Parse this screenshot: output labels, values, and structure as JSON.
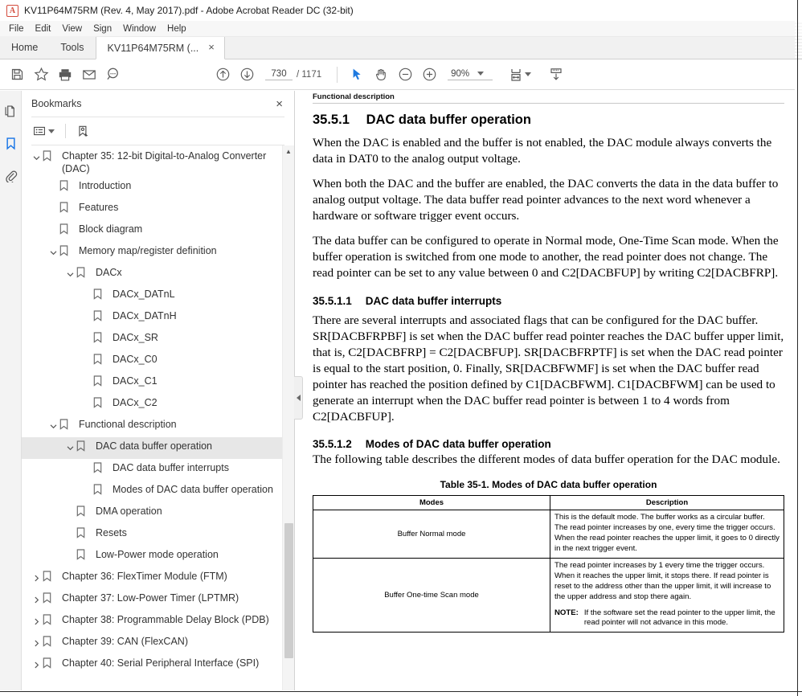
{
  "window": {
    "title": "KV11P64M75RM (Rev. 4, May 2017).pdf - Adobe Acrobat Reader DC (32-bit)",
    "app_icon": "pdf-document-icon",
    "icon_glyph": "A"
  },
  "menubar": {
    "items": [
      {
        "label": "File"
      },
      {
        "label": "Edit"
      },
      {
        "label": "View"
      },
      {
        "label": "Sign"
      },
      {
        "label": "Window"
      },
      {
        "label": "Help"
      }
    ]
  },
  "tabs": [
    {
      "label": "Home",
      "type": "home"
    },
    {
      "label": "Tools",
      "type": "tools"
    },
    {
      "label": "KV11P64M75RM (...",
      "type": "document",
      "close": "×",
      "active": true
    }
  ],
  "toolbar": {
    "left_icons": [
      {
        "name": "save-icon",
        "label": "Save file"
      },
      {
        "name": "star-icon",
        "label": "Add to favorites"
      },
      {
        "name": "print-icon",
        "label": "Print file"
      },
      {
        "name": "email-icon",
        "label": "Send by email"
      },
      {
        "name": "search-icon",
        "label": "Find"
      }
    ],
    "prev_page_label": "Previous page",
    "next_page_label": "Next page",
    "page_number": "730",
    "page_total": "/ 1171",
    "select_tool_label": "Select tool",
    "hand_tool_label": "Hand tool",
    "zoom_out_label": "Zoom out",
    "zoom_in_label": "Zoom in",
    "zoom_value": "90%",
    "fit_label": "Fit page width",
    "scroll_mode_label": "Scroll mode"
  },
  "rail": {
    "items": [
      {
        "name": "page-thumbnails-icon",
        "label": "Page Thumbnails",
        "active": false
      },
      {
        "name": "bookmarks-icon",
        "label": "Bookmarks",
        "active": true
      },
      {
        "name": "attachments-icon",
        "label": "Attachments",
        "active": false
      }
    ]
  },
  "sidebar": {
    "title": "Bookmarks",
    "close_label": "×",
    "tools": [
      {
        "name": "bookmark-options-icon",
        "label": "Options"
      },
      {
        "name": "new-bookmark-icon",
        "label": "New bookmark"
      }
    ],
    "bookmarks": [
      {
        "label": "Chapter 35: 12-bit Digital-to-Analog Converter (DAC)",
        "indent": 0,
        "twisty": "open",
        "selected": false
      },
      {
        "label": "Introduction",
        "indent": 1,
        "twisty": "none",
        "selected": false
      },
      {
        "label": "Features",
        "indent": 1,
        "twisty": "none",
        "selected": false
      },
      {
        "label": "Block diagram",
        "indent": 1,
        "twisty": "none",
        "selected": false
      },
      {
        "label": "Memory map/register definition",
        "indent": 1,
        "twisty": "open",
        "selected": false
      },
      {
        "label": "DACx",
        "indent": 2,
        "twisty": "open",
        "selected": false
      },
      {
        "label": "DACx_DATnL",
        "indent": 3,
        "twisty": "none",
        "selected": false
      },
      {
        "label": "DACx_DATnH",
        "indent": 3,
        "twisty": "none",
        "selected": false
      },
      {
        "label": "DACx_SR",
        "indent": 3,
        "twisty": "none",
        "selected": false
      },
      {
        "label": "DACx_C0",
        "indent": 3,
        "twisty": "none",
        "selected": false
      },
      {
        "label": "DACx_C1",
        "indent": 3,
        "twisty": "none",
        "selected": false
      },
      {
        "label": "DACx_C2",
        "indent": 3,
        "twisty": "none",
        "selected": false
      },
      {
        "label": "Functional description",
        "indent": 1,
        "twisty": "open",
        "selected": false
      },
      {
        "label": "DAC data buffer operation",
        "indent": 2,
        "twisty": "open",
        "selected": true
      },
      {
        "label": "DAC data buffer interrupts",
        "indent": 3,
        "twisty": "none",
        "selected": false
      },
      {
        "label": "Modes of DAC data buffer operation",
        "indent": 3,
        "twisty": "none",
        "selected": false
      },
      {
        "label": "DMA operation",
        "indent": 2,
        "twisty": "none",
        "selected": false
      },
      {
        "label": "Resets",
        "indent": 2,
        "twisty": "none",
        "selected": false
      },
      {
        "label": "Low-Power mode operation",
        "indent": 2,
        "twisty": "none",
        "selected": false
      },
      {
        "label": "Chapter 36: FlexTimer Module (FTM)",
        "indent": 0,
        "twisty": "closed",
        "selected": false
      },
      {
        "label": "Chapter 37: Low-Power Timer (LPTMR)",
        "indent": 0,
        "twisty": "closed",
        "selected": false
      },
      {
        "label": "Chapter 38: Programmable Delay Block (PDB)",
        "indent": 0,
        "twisty": "closed",
        "selected": false
      },
      {
        "label": "Chapter 39: CAN (FlexCAN)",
        "indent": 0,
        "twisty": "closed",
        "selected": false
      },
      {
        "label": "Chapter 40: Serial Peripheral Interface (SPI)",
        "indent": 0,
        "twisty": "closed",
        "selected": false
      }
    ]
  },
  "document": {
    "running_head": "Functional description",
    "section": {
      "number": "35.5.1",
      "title": "DAC data buffer operation"
    },
    "paragraphs": [
      "When the DAC is enabled and the buffer is not enabled, the DAC module always converts the data in DAT0 to the analog output voltage.",
      "When both the DAC and the buffer are enabled, the DAC converts the data in the data buffer to analog output voltage. The data buffer read pointer advances to the next word whenever a hardware or software trigger event occurs.",
      "The data buffer can be configured to operate in Normal mode, One-Time Scan mode. When the buffer operation is switched from one mode to another, the read pointer does not change. The read pointer can be set to any value between 0 and C2[DACBFUP] by writing C2[DACBFRP]."
    ],
    "subsection1": {
      "number": "35.5.1.1",
      "title": "DAC data buffer interrupts"
    },
    "subsection1_paragraph": "There are several interrupts and associated flags that can be configured for the DAC buffer. SR[DACBFRPBF] is set when the DAC buffer read pointer reaches the DAC buffer upper limit, that is, C2[DACBFRP] = C2[DACBFUP]. SR[DACBFRPTF] is set when the DAC read pointer is equal to the start position, 0. Finally, SR[DACBFWMF] is set when the DAC buffer read pointer has reached the position defined by C1[DACBFWM]. C1[DACBFWM] can be used to generate an interrupt when the DAC buffer read pointer is between 1 to 4 words from C2[DACBFUP].",
    "subsection2": {
      "number": "35.5.1.2",
      "title": "Modes of DAC data buffer operation"
    },
    "subsection2_paragraph": "The following table describes the different modes of data buffer operation for the DAC module.",
    "table": {
      "caption": "Table 35-1.   Modes of DAC data buffer operation",
      "headers": [
        "Modes",
        "Description"
      ],
      "rows": [
        {
          "mode": "Buffer Normal mode",
          "description": "This is the default mode. The buffer works as a circular buffer. The read pointer increases by one, every time the trigger occurs. When the read pointer reaches the upper limit, it goes to 0 directly in the next trigger event.",
          "note_label": "",
          "note_text": ""
        },
        {
          "mode": "Buffer One-time Scan mode",
          "description": "The read pointer increases by 1 every time the trigger occurs. When it reaches the upper limit, it stops there. If read pointer is reset to the address other than the upper limit, it will increase to the upper address and stop there again.",
          "note_label": "NOTE:",
          "note_text": "If the software set the read pointer to the upper limit, the read pointer will not advance in this mode."
        }
      ]
    }
  },
  "colors": {
    "accent": "#1473e6",
    "app_icon": "#d34b3c",
    "selection": "#e7e7e7",
    "toolbar_icon": "#5a5a5a"
  }
}
